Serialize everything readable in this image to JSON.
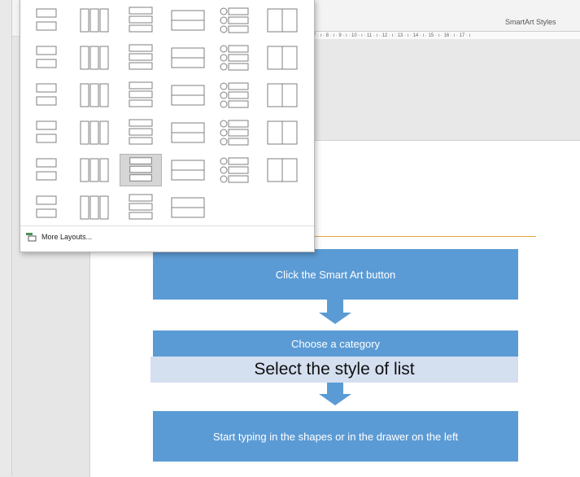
{
  "ribbon": {
    "smartart_styles_label": "SmartArt Styles",
    "ruler_text": "7 · ı · 8 · ı · 9 · ı · 10 · ı · 11 · ı · 12 · ı · 13 · ı · 14 · ı · 15 · ı · 16 · ı · 17 · ı"
  },
  "dropdown": {
    "more_layouts_label": "More Layouts...",
    "layouts": [
      "vertical-bullet-list",
      "stacked-list",
      "vertical-box-list",
      "lined-list",
      "horizontal-bullet-list",
      "pillars-list",
      "picture-caption-list",
      "process-bubbles",
      "linear-dot-flow",
      "descending-steps",
      "trapezoid-list",
      "table-list",
      "grouped-list",
      "round-grouped-list",
      "hierarchy-list",
      "vertical-stacked",
      "segmented-blocks",
      "circle-accent-list",
      "stacked-bars",
      "vertical-block-list",
      "vertical-chevron-list",
      "wrap-arrows",
      "arrow-process",
      "chevron-process",
      "pillar-bars",
      "table-hierarchy",
      "vertical-circle-list",
      "bracket-circle-list",
      "pyramid-list",
      "arc-list",
      "nested-boxes",
      "gear-list",
      "table-blocks",
      "block-matrix"
    ],
    "selected_layout": "vertical-circle-list"
  },
  "diagram": {
    "step1": "Click the Smart Art button",
    "step2": "Choose a category",
    "step3": "Select the style of list",
    "step4": "Start typing in the shapes or in the drawer on the left"
  },
  "colors": {
    "accent": "#5b9bd5",
    "band": "#d4dff0",
    "guide": "#e8a24a"
  }
}
